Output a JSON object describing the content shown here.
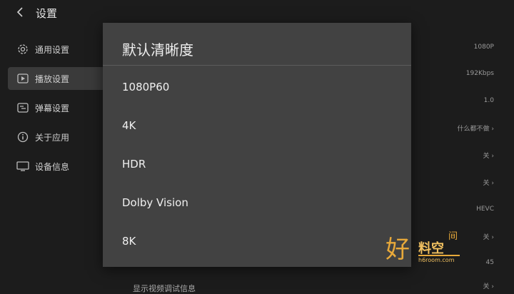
{
  "header": {
    "title": "设置"
  },
  "sidebar": {
    "items": [
      {
        "label": "通用设置",
        "icon": "gear-icon"
      },
      {
        "label": "播放设置",
        "icon": "play-icon",
        "active": true
      },
      {
        "label": "弹幕设置",
        "icon": "danmaku-icon"
      },
      {
        "label": "关于应用",
        "icon": "info-icon"
      },
      {
        "label": "设备信息",
        "icon": "monitor-icon"
      }
    ]
  },
  "settings_values": [
    "1080P",
    "192Kbps",
    "1.0",
    "什么都不做 ›",
    "关 ›",
    "关 ›",
    "HEVC",
    "关 ›",
    "45",
    "关 ›"
  ],
  "bottom_partial_text": "显示视频调试信息",
  "dialog": {
    "title": "默认清晰度",
    "options": [
      "1080P60",
      "4K",
      "HDR",
      "Dolby Vision",
      "8K"
    ]
  },
  "watermark": {
    "big": "好",
    "chars": "料空",
    "top": "间",
    "url": "h6room.com"
  },
  "colors": {
    "background": "#1c1c1c",
    "dialog": "#424242",
    "accent": "#e8a93a"
  }
}
